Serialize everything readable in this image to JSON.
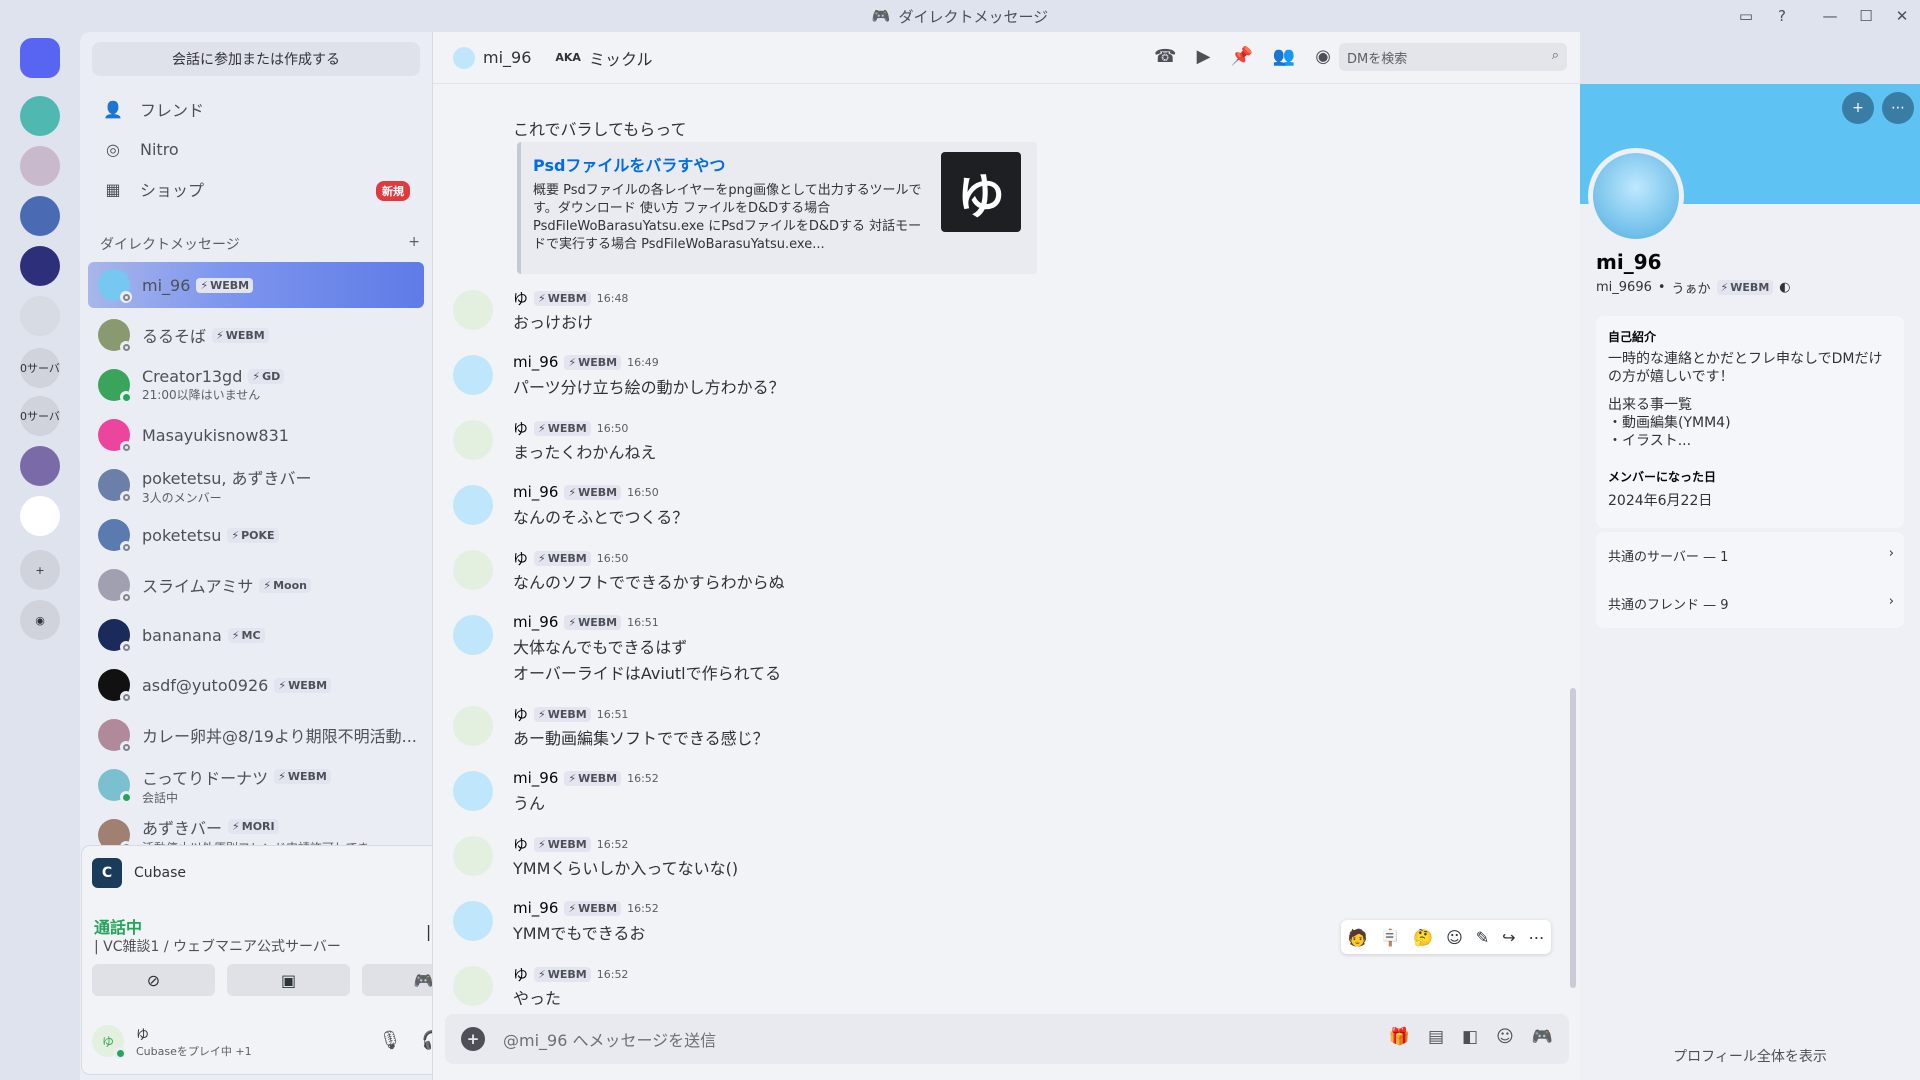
{
  "window": {
    "title": "ダイレクトメッセージ",
    "controls": [
      "—",
      "☐",
      "✕"
    ]
  },
  "guilds": [
    {
      "name": "discord-home",
      "color": "#5865f2",
      "label": ""
    },
    {
      "name": "server-1",
      "color": "#4fb8b0",
      "label": ""
    },
    {
      "name": "server-2",
      "color": "#c8b9cc",
      "label": ""
    },
    {
      "name": "server-3",
      "color": "#4a6ab4",
      "label": ""
    },
    {
      "name": "server-4",
      "color": "#2e2f7a",
      "label": ""
    },
    {
      "name": "server-5",
      "color": "#d7dbe3",
      "label": ""
    },
    {
      "name": "server-6",
      "color": "#d0d3dc",
      "label": "0サーバ"
    },
    {
      "name": "server-7",
      "color": "#d0d3dc",
      "label": "0サーバ"
    },
    {
      "name": "server-8",
      "color": "#7a6aa8",
      "label": ""
    },
    {
      "name": "server-9",
      "color": "#ffffff",
      "label": ""
    }
  ],
  "dm": {
    "search_label": "会話に参加または作成する",
    "nav": [
      {
        "label": "フレンド",
        "icon": "friends-icon"
      },
      {
        "label": "Nitro",
        "icon": "nitro-icon"
      },
      {
        "label": "ショップ",
        "icon": "shop-icon",
        "badge": "新規"
      }
    ],
    "header": "ダイレクトメッセージ",
    "items": [
      {
        "name": "mi_96",
        "tag": "WEBM",
        "sub": "",
        "color": "#76c8f0"
      },
      {
        "name": "るるそば",
        "tag": "WEBM",
        "sub": "",
        "color": "#8a9a70"
      },
      {
        "name": "Creator13gd",
        "tag": "GD",
        "sub": "21:00以降はいません",
        "color": "#3aa55a"
      },
      {
        "name": "Masayukisnow831",
        "tag": "",
        "sub": "",
        "color": "#eb459e"
      },
      {
        "name": "poketetsu, あずきバー",
        "tag": "",
        "sub": "3人のメンバー",
        "color": "#6b7fa8"
      },
      {
        "name": "poketetsu",
        "tag": "POKE",
        "sub": "",
        "color": "#5a7ab0"
      },
      {
        "name": "スライムアミサ",
        "tag": "Moon",
        "sub": "",
        "color": "#a0a0b0"
      },
      {
        "name": "bananana",
        "tag": "MC",
        "sub": "",
        "color": "#1a2a5a"
      },
      {
        "name": "asdf@yuto0926",
        "tag": "WEBM",
        "sub": "",
        "color": "#111111"
      },
      {
        "name": "カレー卵丼@8/19より期限不明活動...",
        "tag": "",
        "sub": "",
        "color": "#b08a9a"
      },
      {
        "name": "こってりドーナツ",
        "tag": "WEBM",
        "sub": "会話中",
        "color": "#7ac0d0"
      },
      {
        "name": "あずきバー",
        "tag": "MORI",
        "sub": "活動停止以外原則フレンド申請許可してま...",
        "color": "#a08070"
      }
    ]
  },
  "voice": {
    "app": "Cubase",
    "status": "通話中",
    "channel": "| VC雑談1 / ウェブマニア公式サーバー"
  },
  "user": {
    "name": "ゆ",
    "activity": "Cubaseをプレイ中 +1"
  },
  "chat": {
    "recipient": "mi_96",
    "aka_label": "AKA",
    "aka_name": "ミックル",
    "search_placeholder": "DMを検索",
    "prev_line": "これでバラしてもらって",
    "embed": {
      "title": "Psdファイルをバラすやつ",
      "desc": "概要 Psdファイルの各レイヤーをpng画像として出力するツールです。ダウンロード 使い方 ファイルをD&Dする場合 PsdFileWoBarasuYatsu.exe にPsdファイルをD&Dする 対話モードで実行する場合 PsdFileWoBarasuYatsu.exe...",
      "thumb": "ゆ"
    },
    "messages": [
      {
        "author": "ゆ",
        "tag": "WEBM",
        "time": "16:48",
        "lines": [
          "おっけおけ"
        ],
        "av": "#e3f0e0"
      },
      {
        "author": "mi_96",
        "tag": "WEBM",
        "time": "16:49",
        "lines": [
          "パーツ分け立ち絵の動かし方わかる？"
        ],
        "av": "#bfe6fb"
      },
      {
        "author": "ゆ",
        "tag": "WEBM",
        "time": "16:50",
        "lines": [
          "まったくわかんねえ"
        ],
        "av": "#e3f0e0"
      },
      {
        "author": "mi_96",
        "tag": "WEBM",
        "time": "16:50",
        "lines": [
          "なんのそふとでつくる？"
        ],
        "av": "#bfe6fb"
      },
      {
        "author": "ゆ",
        "tag": "WEBM",
        "time": "16:50",
        "lines": [
          "なんのソフトでできるかすらわからぬ"
        ],
        "av": "#e3f0e0"
      },
      {
        "author": "mi_96",
        "tag": "WEBM",
        "time": "16:51",
        "lines": [
          "大体なんでもできるはず",
          "オーバーライドはAviutlで作られてる"
        ],
        "av": "#bfe6fb"
      },
      {
        "author": "ゆ",
        "tag": "WEBM",
        "time": "16:51",
        "lines": [
          "あー動画編集ソフトでできる感じ？"
        ],
        "av": "#e3f0e0"
      },
      {
        "author": "mi_96",
        "tag": "WEBM",
        "time": "16:52",
        "lines": [
          "うん"
        ],
        "av": "#bfe6fb"
      },
      {
        "author": "ゆ",
        "tag": "WEBM",
        "time": "16:52",
        "lines": [
          "YMMくらいしか入ってないな()"
        ],
        "av": "#e3f0e0"
      },
      {
        "author": "mi_96",
        "tag": "WEBM",
        "time": "16:52",
        "lines": [
          "YMMでもできるお"
        ],
        "av": "#bfe6fb"
      },
      {
        "author": "ゆ",
        "tag": "WEBM",
        "time": "16:52",
        "lines": [
          "やった"
        ],
        "av": "#e3f0e0"
      }
    ],
    "composer_placeholder": "@mi_96 へメッセージを送信"
  },
  "profile": {
    "display_name": "mi_96",
    "username": "mi_9696",
    "pronoun": "うぁか",
    "tag": "WEBM",
    "about_title": "自己紹介",
    "about_lines": [
      "一時的な連絡とかだとフレ申なしでDMだけの方が嬉しいです！",
      "",
      "出来る事一覧",
      "・動画編集(YMM4)",
      "・イラスト..."
    ],
    "member_since_title": "メンバーになった日",
    "member_since": "2024年6月22日",
    "mutual_servers": "共通のサーバー — 1",
    "mutual_friends": "共通のフレンド — 9",
    "view_full": "プロフィール全体を表示"
  }
}
